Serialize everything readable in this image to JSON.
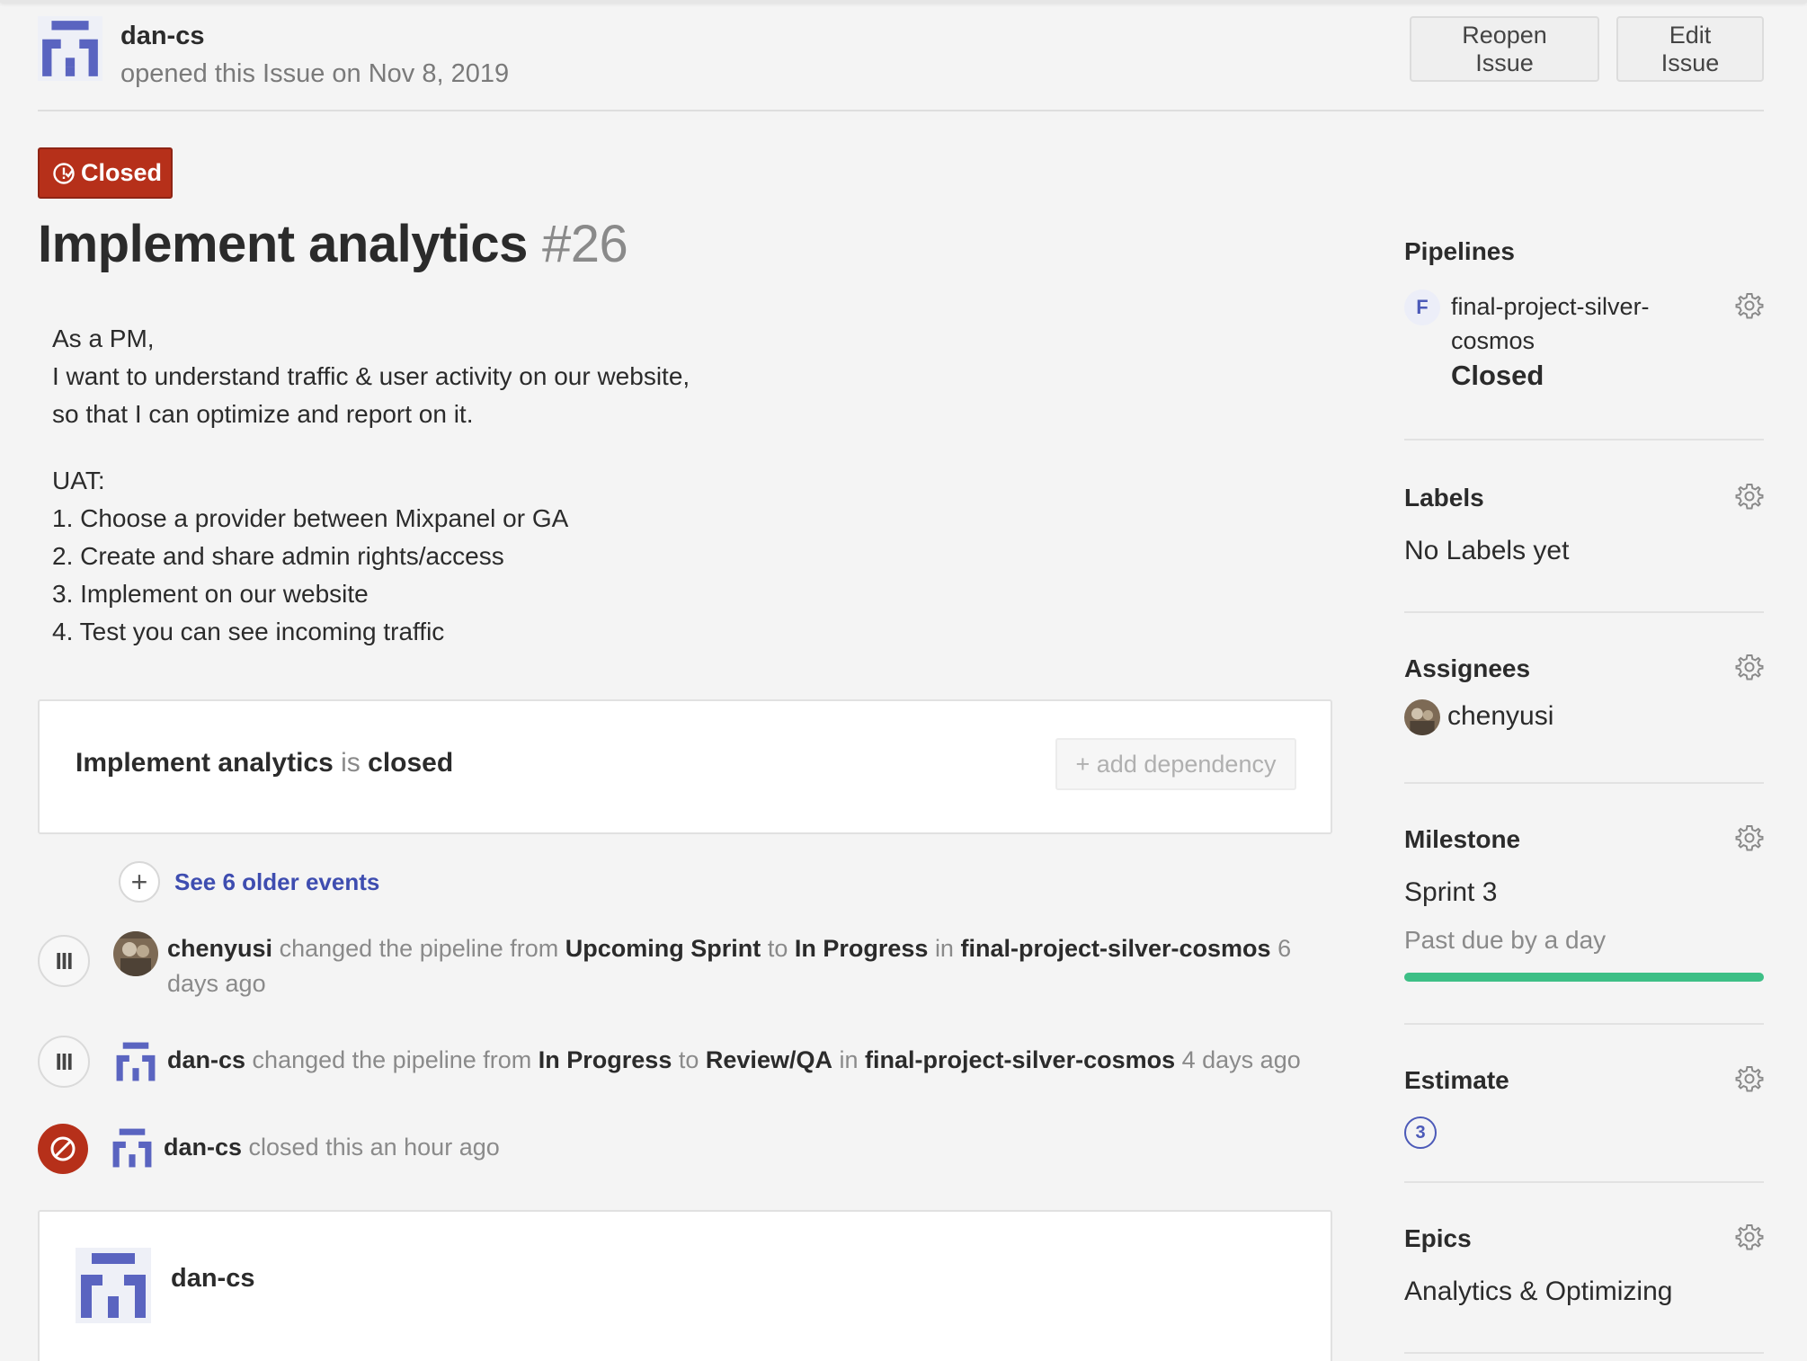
{
  "header": {
    "username": "dan-cs",
    "subtitle": "opened this Issue on Nov 8, 2019",
    "reopen_label": "Reopen Issue",
    "edit_label": "Edit Issue"
  },
  "issue": {
    "status": "Closed",
    "title": "Implement analytics",
    "number": "#26",
    "description": {
      "line1": "As a PM,",
      "line2": "I want to understand traffic & user activity on our website,",
      "line3": "so that I can optimize and report on it.",
      "uat_heading": "UAT:",
      "step1": "1. Choose a provider between Mixpanel or GA",
      "step2": "2. Create and share admin rights/access",
      "step3": "3. Implement on our website",
      "step4": "4. Test you can see incoming traffic"
    }
  },
  "dependency": {
    "issue_name": "Implement analytics",
    "is_word": "is",
    "state": "closed",
    "button_label": "+ add dependency"
  },
  "timeline": {
    "older_events": "See 6 older events",
    "event1": {
      "user": "chenyusi",
      "t1": "changed the pipeline from",
      "from": "Upcoming Sprint",
      "t2": "to",
      "to": "In Progress",
      "t3": "in",
      "workspace": "final-project-silver-cosmos",
      "time": "6 days ago"
    },
    "event2": {
      "user": "dan-cs",
      "t1": "changed the pipeline from",
      "from": "In Progress",
      "t2": "to",
      "to": "Review/QA",
      "t3": "in",
      "workspace": "final-project-silver-cosmos",
      "time": "4 days ago"
    },
    "event3": {
      "user": "dan-cs",
      "text": "closed this an hour ago"
    },
    "event_icon": "III"
  },
  "comment": {
    "username": "dan-cs"
  },
  "sidebar": {
    "pipelines": {
      "heading": "Pipelines",
      "badge": "F",
      "workspace_line1": "final-project-silver-",
      "workspace_line2": "cosmos",
      "state": "Closed"
    },
    "labels": {
      "heading": "Labels",
      "value": "No Labels yet"
    },
    "assignees": {
      "heading": "Assignees",
      "value": "chenyusi"
    },
    "milestone": {
      "heading": "Milestone",
      "value": "Sprint 3",
      "due": "Past due by a day",
      "progress": 1.0
    },
    "estimate": {
      "heading": "Estimate",
      "value": "3"
    },
    "epics": {
      "heading": "Epics",
      "value": "Analytics & Optimizing"
    }
  },
  "colors": {
    "accent": "#4c5ab8",
    "closed_red": "#b6301a",
    "progress_green": "#3dbf86",
    "link_blue": "#3e4db0"
  }
}
